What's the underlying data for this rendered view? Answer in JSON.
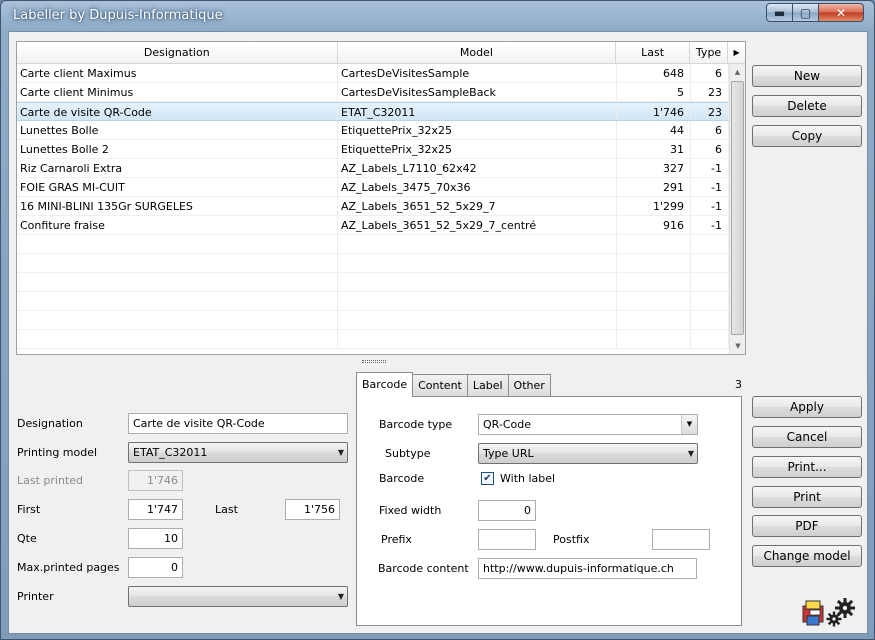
{
  "window": {
    "title": "Labeller by Dupuis-Informatique"
  },
  "grid": {
    "columns": [
      "Designation",
      "Model",
      "Last",
      "Type"
    ],
    "rows": [
      {
        "designation": "Carte client Maximus",
        "model": "CartesDeVisitesSample",
        "last": "648",
        "type": "6"
      },
      {
        "designation": "Carte client Minimus",
        "model": "CartesDeVisitesSampleBack",
        "last": "5",
        "type": "23"
      },
      {
        "designation": "Carte de visite QR-Code",
        "model": "ETAT_C32011",
        "last": "1'746",
        "type": "23"
      },
      {
        "designation": "Lunettes Bolle",
        "model": "EtiquettePrix_32x25",
        "last": "44",
        "type": "6"
      },
      {
        "designation": "Lunettes Bolle 2",
        "model": "EtiquettePrix_32x25",
        "last": "31",
        "type": "6"
      },
      {
        "designation": "Riz Carnaroli Extra",
        "model": "AZ_Labels_L7110_62x42",
        "last": "327",
        "type": "-1"
      },
      {
        "designation": "FOIE GRAS MI-CUIT",
        "model": "AZ_Labels_3475_70x36",
        "last": "291",
        "type": "-1"
      },
      {
        "designation": "16 MINI-BLINI 135Gr SURGELES",
        "model": "AZ_Labels_3651_52_5x29_7",
        "last": "1'299",
        "type": "-1"
      },
      {
        "designation": "Confiture fraise",
        "model": "AZ_Labels_3651_52_5x29_7_centré",
        "last": "916",
        "type": "-1"
      }
    ],
    "selected_row": 2
  },
  "top_buttons": {
    "new": "New",
    "delete": "Delete",
    "copy": "Copy"
  },
  "side_buttons": {
    "apply": "Apply",
    "cancel": "Cancel",
    "print_dialog": "Print...",
    "print": "Print",
    "pdf": "PDF",
    "change_model": "Change model"
  },
  "form": {
    "designation_label": "Designation",
    "designation_value": "Carte de visite QR-Code",
    "printing_model_label": "Printing model",
    "printing_model_value": "ETAT_C32011",
    "last_printed_label": "Last printed",
    "last_printed_value": "1'746",
    "first_label": "First",
    "first_value": "1'747",
    "last_label": "Last",
    "last_value": "1'756",
    "qte_label": "Qte",
    "qte_value": "10",
    "max_pages_label": "Max.printed pages",
    "max_pages_value": "0",
    "printer_label": "Printer",
    "printer_value": ""
  },
  "tabs": {
    "items": [
      "Barcode",
      "Content",
      "Label",
      "Other"
    ],
    "active": 0,
    "count": "3"
  },
  "barcode": {
    "type_label": "Barcode type",
    "type_value": "QR-Code",
    "subtype_label": "Subtype",
    "subtype_value": "Type URL",
    "barcode_label": "Barcode",
    "with_label": "With label",
    "with_label_checked": true,
    "fixed_width_label": "Fixed width",
    "fixed_width_value": "0",
    "prefix_label": "Prefix",
    "prefix_value": "",
    "postfix_label": "Postfix",
    "postfix_value": "",
    "content_label": "Barcode content",
    "content_value": "http://www.dupuis-informatique.ch"
  },
  "icons": {
    "minimize": "minimize-icon",
    "maximize": "maximize-icon",
    "close": "close-icon",
    "dropdown": "chevron-down-icon",
    "tools": "gears-icon",
    "printer": "printer-icon"
  }
}
